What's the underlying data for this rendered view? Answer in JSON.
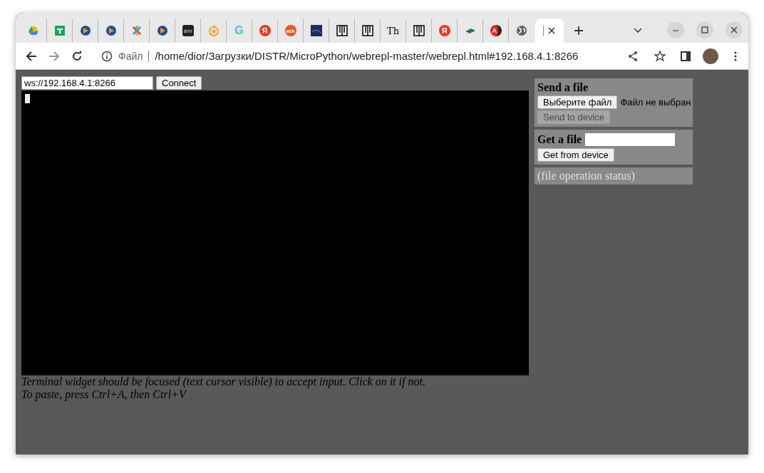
{
  "tabs": [
    {
      "kind": "drive",
      "selected": false
    },
    {
      "kind": "sheet",
      "selected": false
    },
    {
      "kind": "player",
      "selected": false
    },
    {
      "kind": "player",
      "selected": false
    },
    {
      "kind": "joomla",
      "selected": false
    },
    {
      "kind": "player",
      "selected": false
    },
    {
      "kind": "dark",
      "glyph": "arm",
      "selected": false
    },
    {
      "kind": "orange",
      "selected": false
    },
    {
      "kind": "cyan",
      "glyph": "G",
      "selected": false
    },
    {
      "kind": "redround",
      "glyph": "Я",
      "selected": false
    },
    {
      "kind": "orangeround",
      "glyph": "ask",
      "selected": false
    },
    {
      "kind": "navy",
      "selected": false
    },
    {
      "kind": "bars",
      "selected": false
    },
    {
      "kind": "bars",
      "selected": false
    },
    {
      "kind": "black",
      "glyph": "Th",
      "selected": false
    },
    {
      "kind": "bars",
      "selected": false
    },
    {
      "kind": "redround",
      "glyph": "Я",
      "selected": false
    },
    {
      "kind": "board",
      "selected": false
    },
    {
      "kind": "split",
      "glyph": "A",
      "selected": false
    },
    {
      "kind": "globe",
      "selected": false
    },
    {
      "kind": "cursor",
      "selected": true
    }
  ],
  "address": {
    "scheme": "Файл",
    "url": "/home/dior/Загрузки/DISTR/MicroPython/webrepl-master/webrepl.html#192.168.4.1:8266"
  },
  "connection": {
    "url": "ws://192.168.4.1:8266",
    "button": "Connect"
  },
  "notes": [
    "Terminal widget should be focused (text cursor visible) to accept input. Click on it if not.",
    "To paste, press Ctrl+A, then Ctrl+V"
  ],
  "send": {
    "title": "Send a file",
    "choose": "Выберите файл",
    "chosen": "Файл не выбран",
    "button": "Send to device",
    "disabled": true
  },
  "get": {
    "title": "Get a file",
    "button": "Get from device"
  },
  "status": "(file operation status)"
}
